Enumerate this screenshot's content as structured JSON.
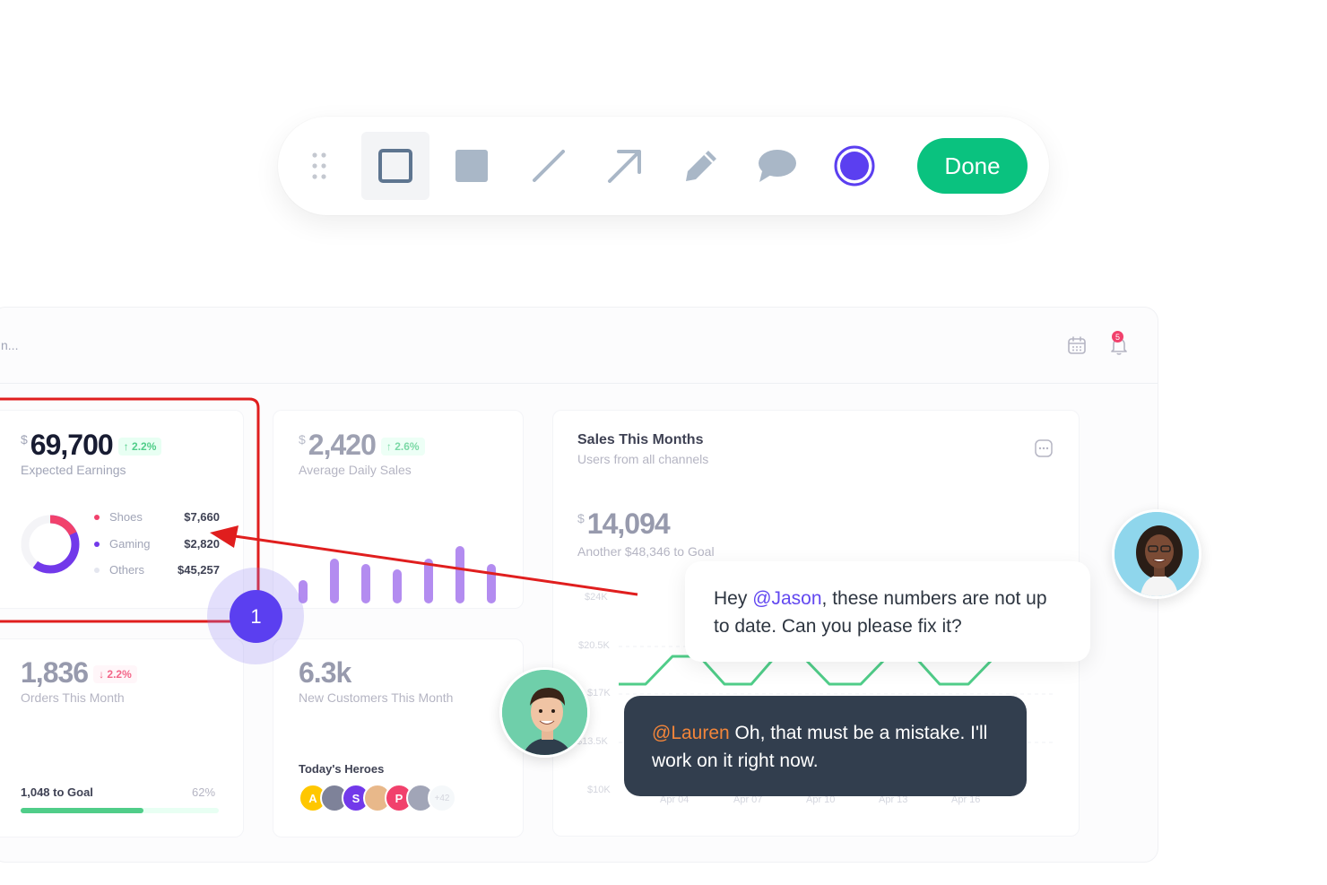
{
  "toolbar": {
    "tools": [
      {
        "name": "drag-handle",
        "active": false
      },
      {
        "name": "rectangle-outline",
        "active": true
      },
      {
        "name": "rectangle-filled",
        "active": false
      },
      {
        "name": "line",
        "active": false
      },
      {
        "name": "arrow",
        "active": false
      },
      {
        "name": "pencil",
        "active": false
      },
      {
        "name": "comment",
        "active": false
      },
      {
        "name": "color-picker",
        "active": false
      }
    ],
    "selected_color": "#5b3ff0",
    "done_label": "Done"
  },
  "header": {
    "search_text": "n...",
    "notification_count": "5"
  },
  "expected_earnings": {
    "currency": "$",
    "value": "69,700",
    "change": "2.2%",
    "label": "Expected Earnings",
    "legend": [
      {
        "label": "Shoes",
        "value": "$7,660",
        "color": "#f1416c"
      },
      {
        "label": "Gaming",
        "value": "$2,820",
        "color": "#7239ea"
      },
      {
        "label": "Others",
        "value": "$45,257",
        "color": "#e4e6ef"
      }
    ]
  },
  "daily_sales": {
    "currency": "$",
    "value": "2,420",
    "change": "2.6%",
    "label": "Average Daily Sales"
  },
  "sales_month": {
    "title": "Sales This Months",
    "subtitle": "Users from all channels",
    "currency": "$",
    "value": "14,094",
    "goal_text": "Another $48,346 to Goal",
    "y_ticks": [
      "$24K",
      "$20.5K",
      "$17K",
      "$13.5K",
      "$10K"
    ],
    "x_ticks": [
      "Apr 04",
      "Apr 07",
      "Apr 10",
      "Apr 13",
      "Apr 16"
    ]
  },
  "orders": {
    "value": "1,836",
    "change": "2.2%",
    "label": "Orders This Month",
    "goal_label": "1,048 to Goal",
    "goal_percent_text": "62%",
    "progress": 0.62
  },
  "customers": {
    "value": "6.3k",
    "label": "New Customers This Month",
    "heroes_title": "Today's Heroes",
    "heroes": [
      {
        "initial": "A",
        "color": "#ffc700"
      },
      {
        "initial": "",
        "color": "#7e8299"
      },
      {
        "initial": "S",
        "color": "#7239ea"
      },
      {
        "initial": "",
        "color": "#e8b88a"
      },
      {
        "initial": "P",
        "color": "#f1416c"
      },
      {
        "initial": "",
        "color": "#a1a5b7"
      }
    ],
    "heroes_more": "+42"
  },
  "step_marker": "1",
  "chat": {
    "message1": {
      "prefix": "Hey ",
      "mention": "@Jason",
      "text": ", these numbers are not up to date. Can you please fix it?"
    },
    "message2": {
      "mention": "@Lauren",
      "text": " Oh, that must be a mistake. I'll work on it right now."
    }
  },
  "colors": {
    "done_green": "#0ac27f",
    "annotation_red": "#e01e1e",
    "chart_green": "#50cd89",
    "bar_purple": "#b38cf0"
  }
}
